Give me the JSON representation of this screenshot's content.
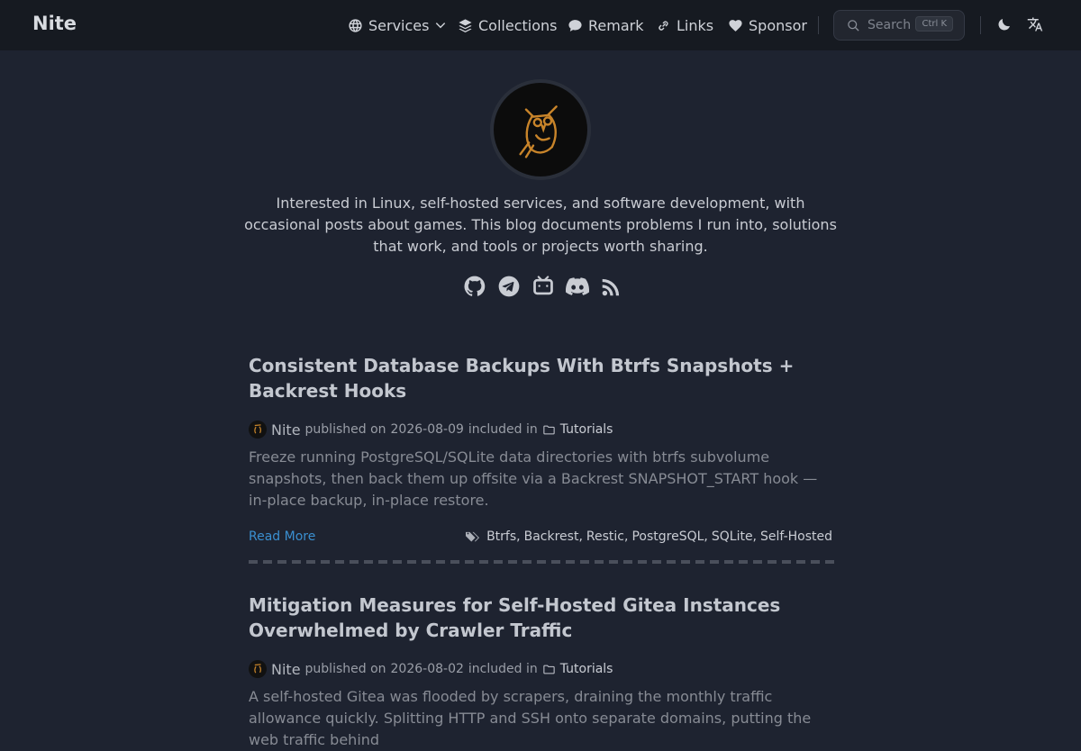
{
  "header": {
    "brand": "Nite",
    "nav": [
      {
        "label": "Services",
        "icon": "globe-icon"
      },
      {
        "label": "Collections",
        "icon": "layers-icon"
      },
      {
        "label": "Remark",
        "icon": "comment-icon"
      },
      {
        "label": "Links",
        "icon": "link-icon"
      },
      {
        "label": "Sponsor",
        "icon": "heart-icon"
      }
    ],
    "search": {
      "placeholder": "Search",
      "shortcut": "Ctrl K"
    }
  },
  "profile": {
    "bio": "Interested in Linux, self-hosted services, and software development, with occasional posts about games. This blog documents problems I run into, solutions that work, and tools or projects worth sharing.",
    "socials": [
      "github-icon",
      "telegram-icon",
      "bilibili-icon",
      "discord-icon",
      "rss-icon"
    ]
  },
  "posts": [
    {
      "title": "Consistent Database Backups With Btrfs Snapshots + Backrest Hooks",
      "author": "Nite",
      "published_prefix": "published on",
      "date": "2026-08-09",
      "included_prefix": "included in",
      "category": "Tutorials",
      "summary": "Freeze running PostgreSQL/SQLite data directories with btrfs subvolume snapshots, then back them up offsite via a Backrest SNAPSHOT_START hook — in-place backup, in-place restore.",
      "read_more": "Read More",
      "tags": [
        "Btrfs,",
        "Backrest,",
        "Restic,",
        "PostgreSQL,",
        "SQLite,",
        "Self-Hosted"
      ]
    },
    {
      "title": "Mitigation Measures for Self-Hosted Gitea Instances Overwhelmed by Crawler Traffic",
      "author": "Nite",
      "published_prefix": "published on",
      "date": "2026-08-02",
      "included_prefix": "included in",
      "category": "Tutorials",
      "summary": "A self-hosted Gitea was flooded by scrapers, draining the monthly traffic allowance quickly. Splitting HTTP and SSH onto separate domains, putting the web traffic behind"
    }
  ]
}
